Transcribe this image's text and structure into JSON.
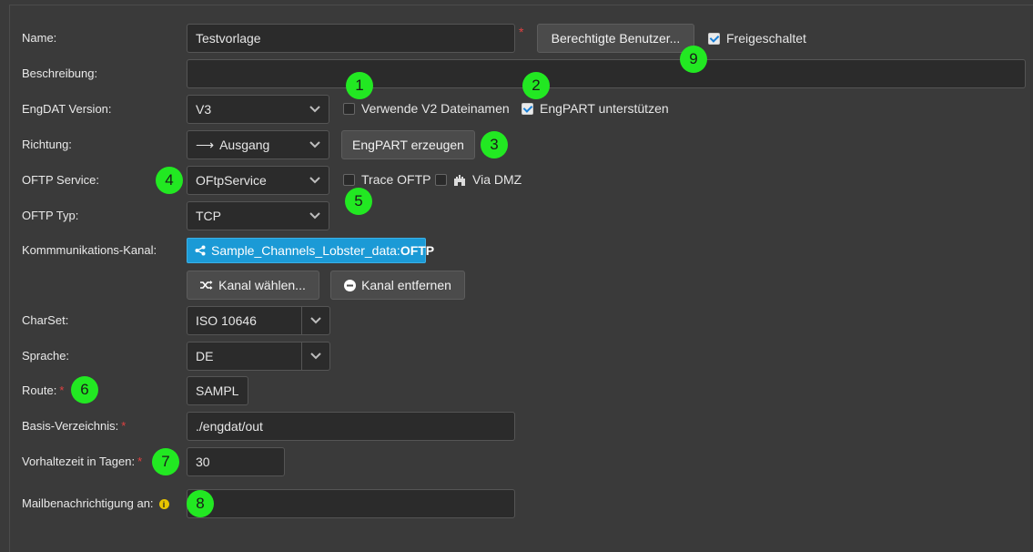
{
  "labels": {
    "name": "Name:",
    "description": "Beschreibung:",
    "engdat_version": "EngDAT Version:",
    "direction": "Richtung:",
    "oftp_service": "OFTP Service:",
    "oftp_type": "OFTP Typ:",
    "channel": "Kommmunikations-Kanal:",
    "charset": "CharSet:",
    "language": "Sprache:",
    "route": "Route:",
    "base_dir": "Basis-Verzeichnis:",
    "retention": "Vorhaltezeit in Tagen:",
    "mail": "Mailbenachrichtigung an:"
  },
  "required_mark": "*",
  "fields": {
    "name": "Testvorlage",
    "description": "",
    "engdat_version": "V3",
    "direction": "Ausgang",
    "direction_arrow": "⟶",
    "oftp_service": "OFtpService",
    "oftp_type": "TCP",
    "charset": "ISO 10646",
    "language": "DE",
    "route": "SAMPL",
    "base_dir": "./engdat/out",
    "retention": "30",
    "mail": ""
  },
  "channel": {
    "name": "Sample_Channels_Lobster_data:",
    "protocol": "OFTP",
    "icon": "share-icon"
  },
  "buttons": {
    "authorized_users": "Berechtigte Benutzer...",
    "engpart_generate": "EngPART erzeugen",
    "choose_channel": "Kanal wählen...",
    "remove_channel": "Kanal entfernen"
  },
  "checkboxes": {
    "unlocked": {
      "label": "Freigeschaltet",
      "checked": true
    },
    "v2_filenames": {
      "label": "Verwende V2 Dateinamen",
      "checked": false
    },
    "engpart_support": {
      "label": "EngPART unterstützen",
      "checked": true
    },
    "trace_oftp": {
      "label": "Trace OFTP",
      "checked": false
    },
    "via_dmz": {
      "label": "Via DMZ",
      "checked": false
    }
  },
  "badges": [
    "1",
    "2",
    "3",
    "4",
    "5",
    "6",
    "7",
    "8",
    "9"
  ],
  "info_icon": "i",
  "colors": {
    "badge": "#22e822",
    "channel": "#1b9ad6",
    "required": "#e04040",
    "check": "#1a7fd6"
  }
}
